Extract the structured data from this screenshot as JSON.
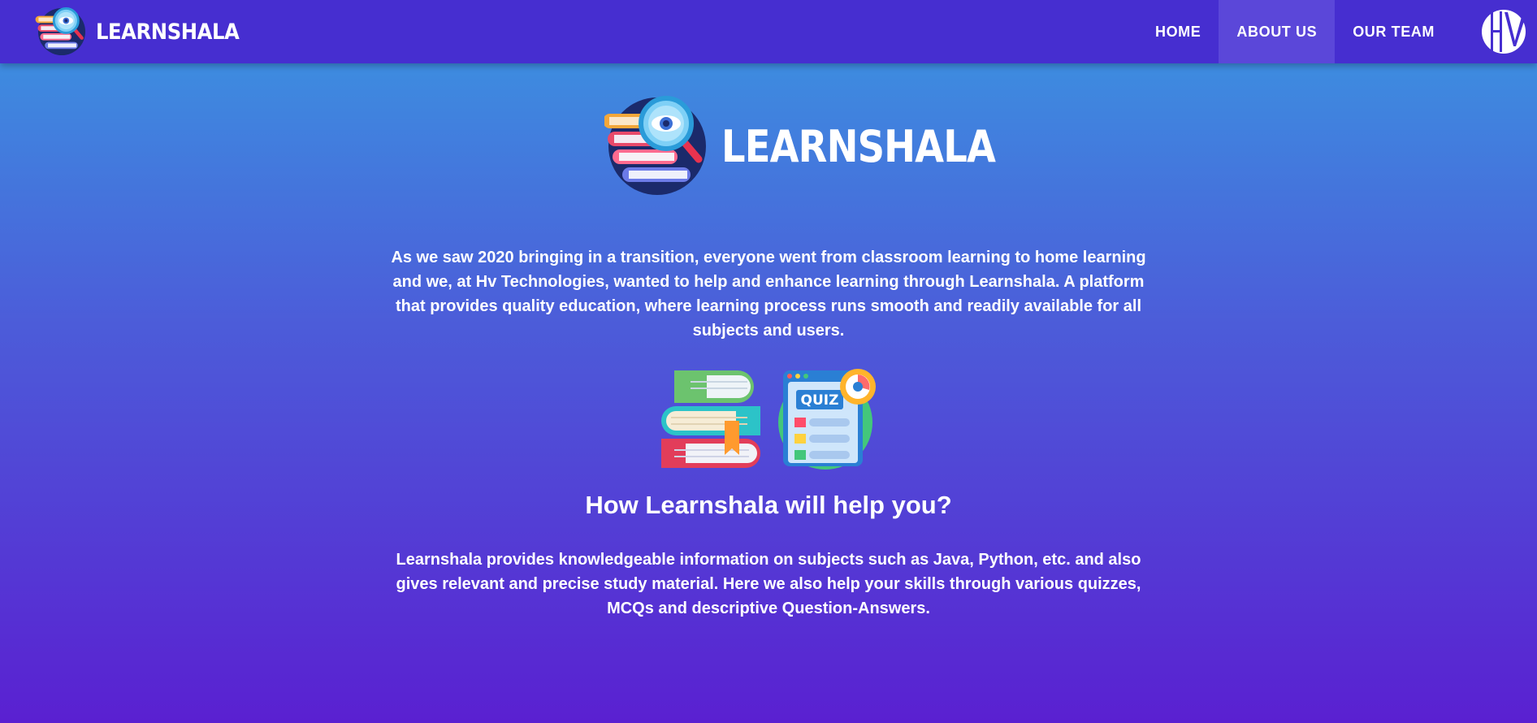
{
  "navbar": {
    "brand": {
      "name": "LEARNSHALA",
      "logo_icon": "books-magnifier-icon"
    },
    "links": [
      {
        "label": "HOME",
        "active": false
      },
      {
        "label": "ABOUT US",
        "active": true
      },
      {
        "label": "OUR TEAM",
        "active": false
      }
    ],
    "company_logo_icon": "hv-logo"
  },
  "hero": {
    "name": "LEARNSHALA",
    "logo_icon": "books-magnifier-icon"
  },
  "intro": {
    "text": "As we saw 2020 bringing in a transition, everyone went from classroom learning to home learning and we, at Hv Technologies, wanted to help and enhance learning through Learnshala. A platform that provides quality education, where learning process runs smooth and readily available for all subjects and users."
  },
  "illustrations": {
    "left_icon": "book-stack-icon",
    "right_icon": "quiz-icon",
    "quiz_label": "QUIZ"
  },
  "help": {
    "heading": "How Learnshala will help you?",
    "text": "Learnshala provides knowledgeable information on subjects such as Java, Python, etc. and also gives relevant and precise study material. Here we also help your skills through various quizzes, MCQs and descriptive Question-Answers."
  },
  "colors": {
    "navbar_bg": "#462ed0",
    "nav_active_bg": "#5b47d9",
    "gradient_top": "#3a97e1",
    "gradient_bottom": "#5a20d1",
    "text": "#ffffff"
  }
}
